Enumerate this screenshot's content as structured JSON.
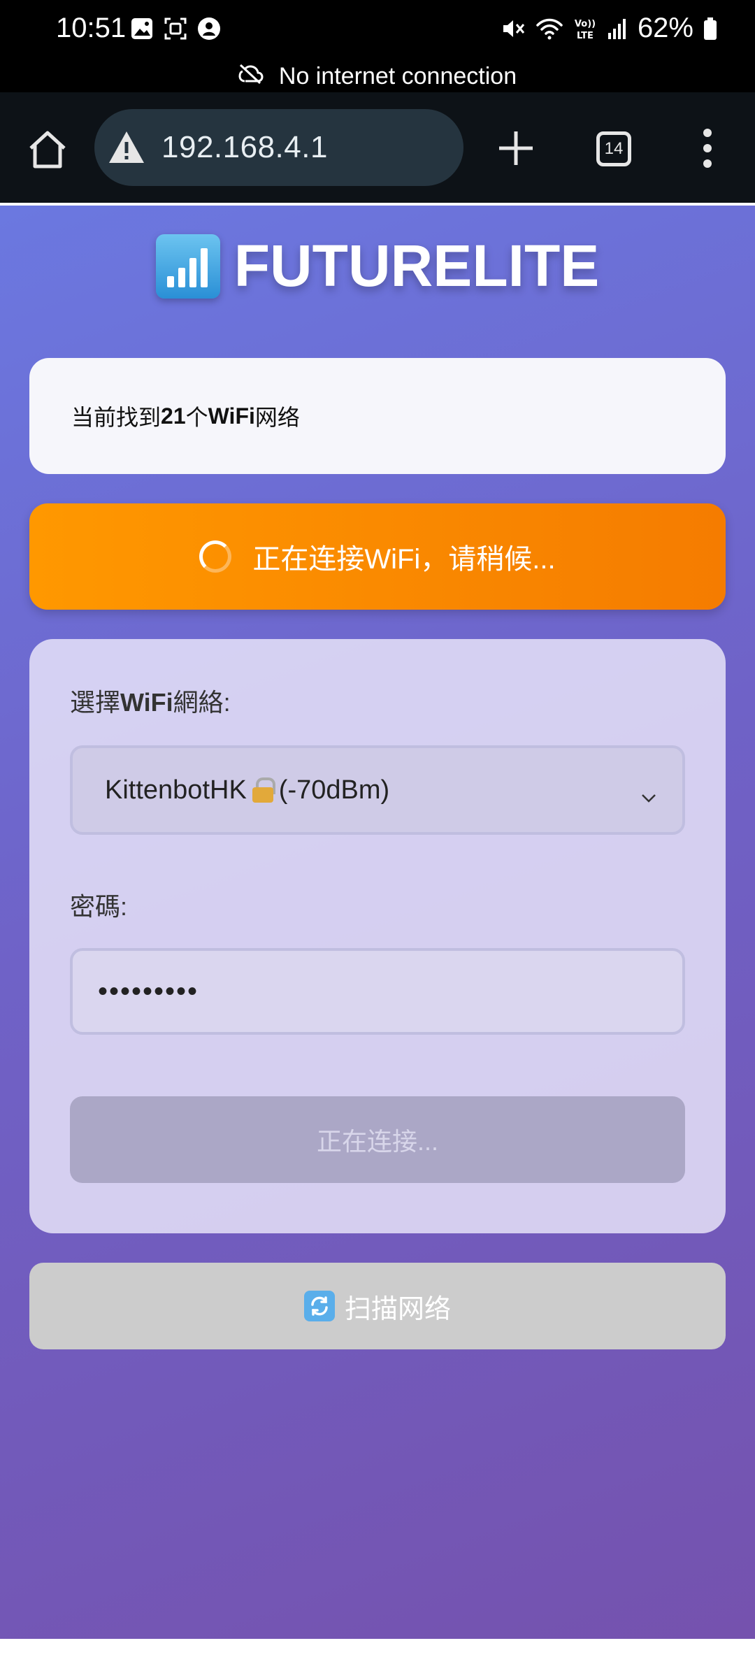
{
  "status_bar": {
    "time": "10:51",
    "battery": "62%",
    "icons": [
      "image-icon",
      "screenshot-icon",
      "account-icon",
      "mute-icon",
      "wifi-icon",
      "volte-icon",
      "signal-icon",
      "battery-icon"
    ]
  },
  "network_banner": {
    "text": "No internet connection"
  },
  "browser": {
    "url": "192.168.4.1",
    "tab_count": "14",
    "page_load_progress": 0.05
  },
  "header": {
    "title": "FUTURELITE"
  },
  "info": {
    "prefix": "当前找到",
    "count": "21",
    "middle": "个",
    "wifi_bold": "WiFi",
    "suffix": "网络"
  },
  "connecting": {
    "text": "正在连接WiFi，请稍候..."
  },
  "form": {
    "select_label_prefix": "選擇",
    "select_label_bold": "WiFi",
    "select_label_suffix": "網絡:",
    "selected_network_name": "KittenbotHK",
    "selected_network_signal": "(-70dBm)",
    "password_label": "密碼:",
    "password_value": "•••••••••",
    "connect_button": "正在连接..."
  },
  "scan_button": {
    "label": "扫描网络"
  },
  "colors": {
    "banner_orange": "#ff9800",
    "gradient_start": "#6b78e0",
    "gradient_end": "#7552ae"
  }
}
